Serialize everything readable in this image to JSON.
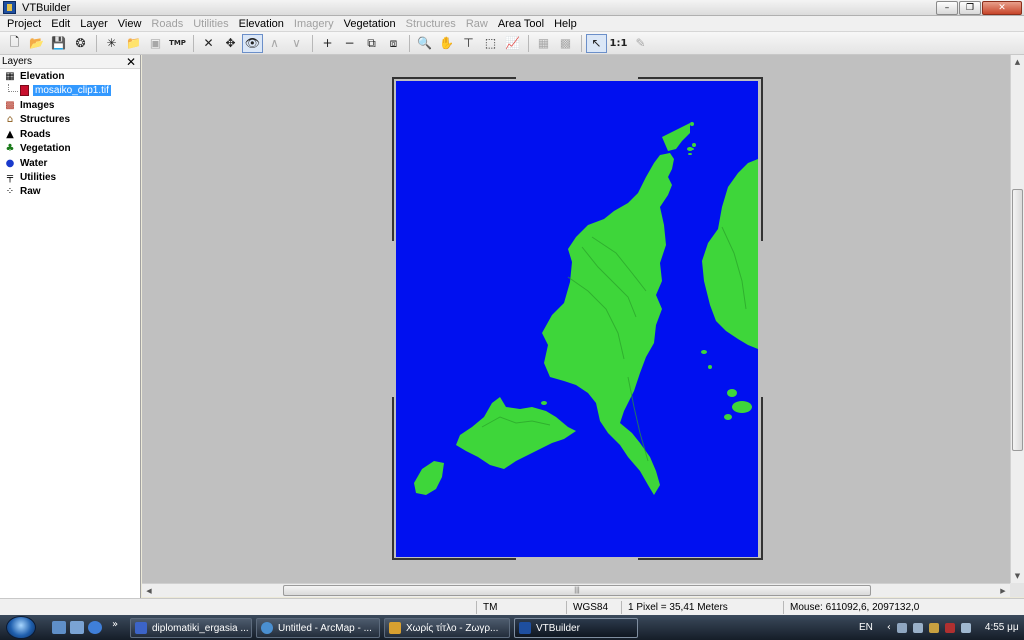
{
  "window": {
    "title": "VTBuilder",
    "minimize": "–",
    "maximize": "❐",
    "close": "✕"
  },
  "menu": [
    {
      "label": "Project",
      "enabled": true
    },
    {
      "label": "Edit",
      "enabled": true
    },
    {
      "label": "Layer",
      "enabled": true
    },
    {
      "label": "View",
      "enabled": true
    },
    {
      "label": "Roads",
      "enabled": false
    },
    {
      "label": "Utilities",
      "enabled": false
    },
    {
      "label": "Elevation",
      "enabled": true
    },
    {
      "label": "Imagery",
      "enabled": false
    },
    {
      "label": "Vegetation",
      "enabled": true
    },
    {
      "label": "Structures",
      "enabled": false
    },
    {
      "label": "Raw",
      "enabled": false
    },
    {
      "label": "Area Tool",
      "enabled": true
    },
    {
      "label": "Help",
      "enabled": true
    }
  ],
  "toolbar": {
    "one_to_one_label": "1:1",
    "tmp_label": "TMP"
  },
  "layers": {
    "title": "Layers",
    "close": "✕",
    "groups": [
      {
        "name": "Elevation",
        "icon": "elevation-grid-icon"
      },
      {
        "name": "Images",
        "icon": "images-icon"
      },
      {
        "name": "Structures",
        "icon": "house-icon"
      },
      {
        "name": "Roads",
        "icon": "road-icon"
      },
      {
        "name": "Vegetation",
        "icon": "tree-icon"
      },
      {
        "name": "Water",
        "icon": "water-drop-icon"
      },
      {
        "name": "Utilities",
        "icon": "utility-pole-icon"
      },
      {
        "name": "Raw",
        "icon": "raw-points-icon"
      }
    ],
    "elevation_file": "mosaiko_clip1.tif"
  },
  "colors": {
    "water": "#0010f0",
    "land": "#3ed63a",
    "canvas": "#c0c0c0",
    "selection": "#3399ff"
  },
  "status": {
    "projection": "TM",
    "datum": "WGS84",
    "pixel_size": "1 Pixel = 35,41 Meters",
    "mouse": "Mouse: 611092,6, 2097132,0"
  },
  "taskbar": {
    "tasks": [
      {
        "label": "diplomatiki_ergasia ...",
        "active": false
      },
      {
        "label": "Untitled - ArcMap - ...",
        "active": false
      },
      {
        "label": "Χωρίς τίτλο - Ζωγρ...",
        "active": false
      },
      {
        "label": "VTBuilder",
        "active": true
      }
    ],
    "language": "EN",
    "clock": "4:55 μμ"
  }
}
